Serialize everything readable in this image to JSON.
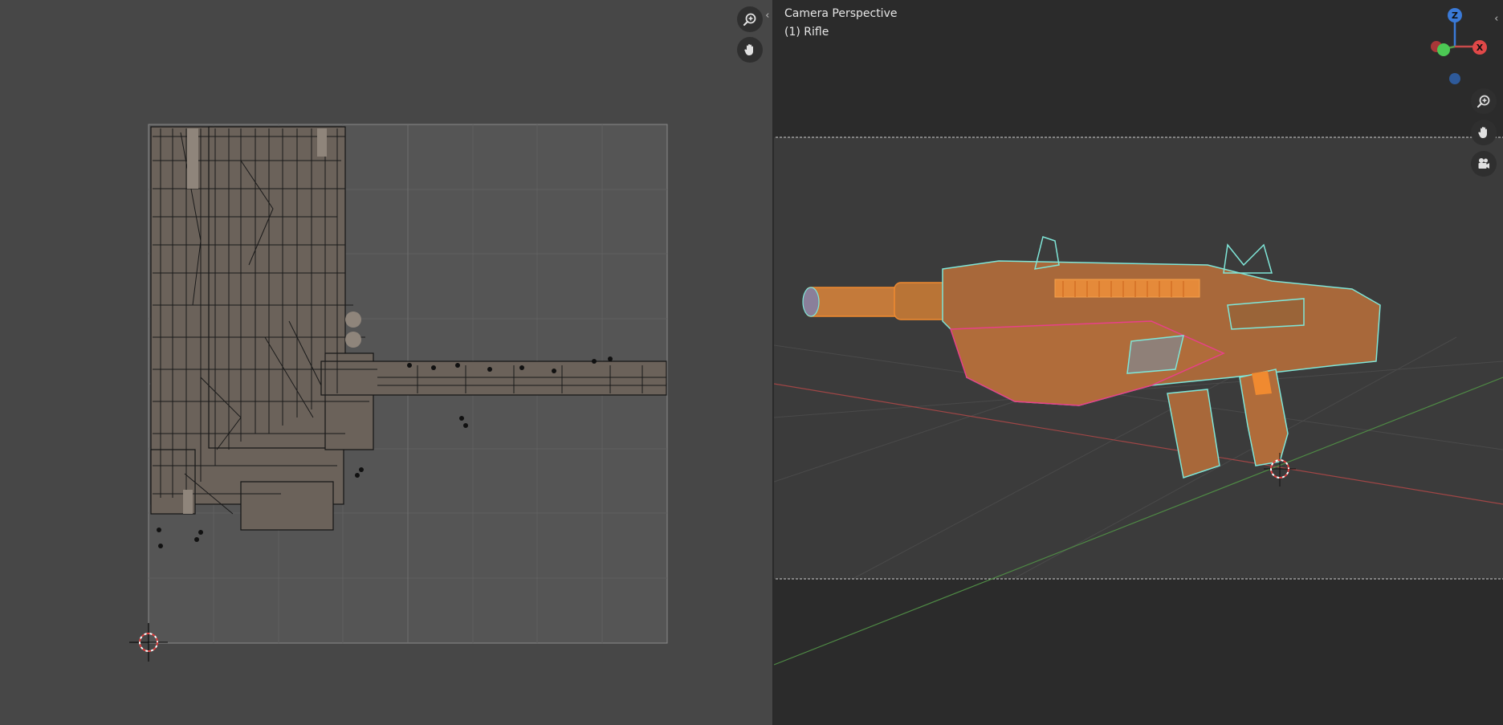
{
  "uv_editor": {
    "zoom_tool_icon": "zoom-in-icon",
    "pan_tool_icon": "hand-icon"
  },
  "viewport": {
    "camera_label": "Camera Perspective",
    "object_label": "(1) Rifle",
    "gizmo": {
      "z_label": "Z",
      "x_label": "X"
    },
    "tools": [
      "zoom-in-icon",
      "hand-icon",
      "camera-icon"
    ]
  },
  "colors": {
    "accent_orange": "#e88a2c",
    "wire_cyan": "#7fe6d8",
    "wire_pink": "#e8408a",
    "axis_red": "#c84b4b",
    "axis_green": "#5a9a4a",
    "axis_blue": "#3a7ad8"
  }
}
